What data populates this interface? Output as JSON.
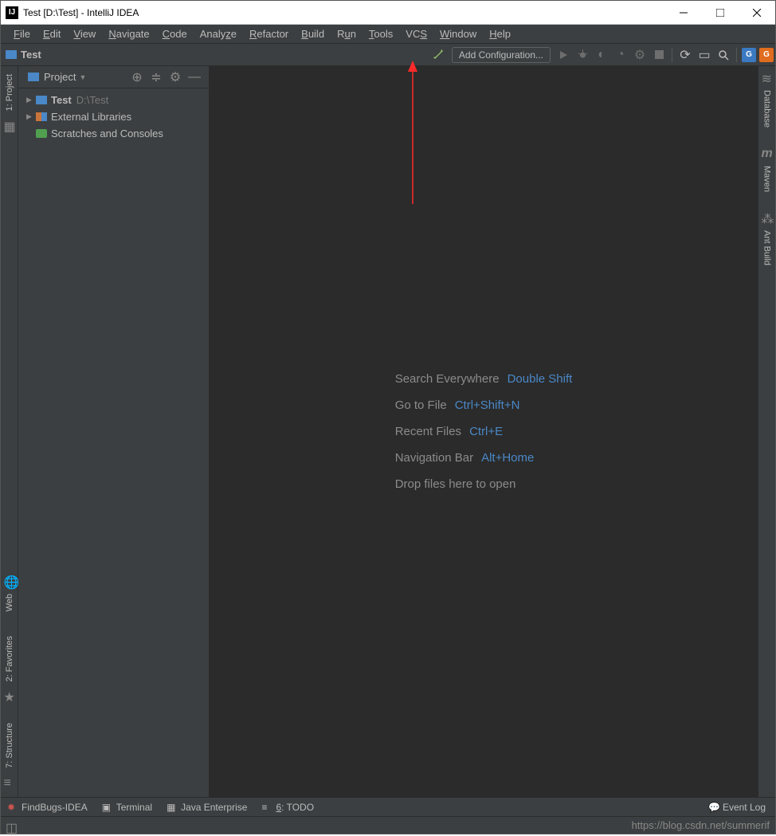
{
  "title": "Test [D:\\Test] - IntelliJ IDEA",
  "menus": [
    "File",
    "Edit",
    "View",
    "Navigate",
    "Code",
    "Analyze",
    "Refactor",
    "Build",
    "Run",
    "Tools",
    "VCS",
    "Window",
    "Help"
  ],
  "breadcrumb": "Test",
  "add_config": "Add Configuration...",
  "side": {
    "label": "Project"
  },
  "tree": {
    "root_label": "Test",
    "root_path": "D:\\Test",
    "ext_lib": "External Libraries",
    "scratch": "Scratches and Consoles"
  },
  "hints": [
    {
      "label": "Search Everywhere",
      "key": "Double Shift"
    },
    {
      "label": "Go to File",
      "key": "Ctrl+Shift+N"
    },
    {
      "label": "Recent Files",
      "key": "Ctrl+E"
    },
    {
      "label": "Navigation Bar",
      "key": "Alt+Home"
    },
    {
      "label": "Drop files here to open",
      "key": ""
    }
  ],
  "left_rail": {
    "project": "1: Project",
    "web": "Web",
    "favorites": "2: Favorites",
    "structure": "7: Structure"
  },
  "right_rail": {
    "database": "Database",
    "maven": "Maven",
    "ant": "Ant Build"
  },
  "status": {
    "findbugs": "FindBugs-IDEA",
    "terminal": "Terminal",
    "je": "Java Enterprise",
    "todo": "6: TODO",
    "eventlog": "Event Log"
  },
  "watermark": "https://blog.csdn.net/summerif"
}
